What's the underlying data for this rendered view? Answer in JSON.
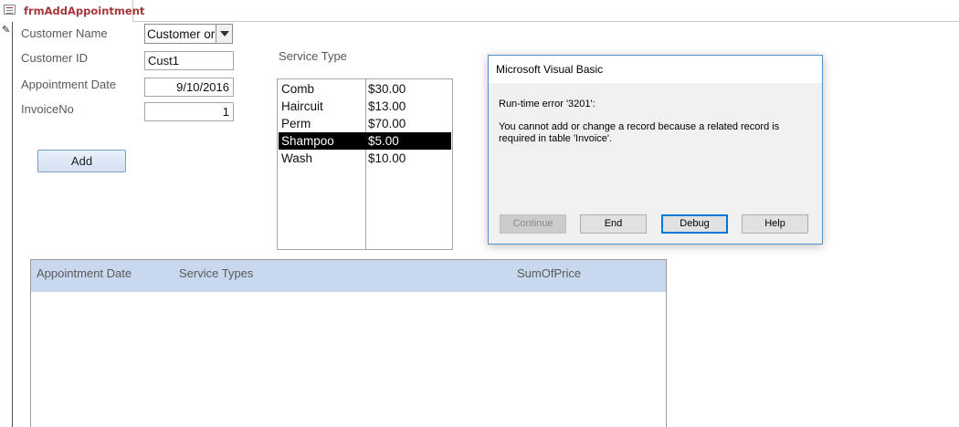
{
  "tab": {
    "title": "frmAddAppointment"
  },
  "form": {
    "customer_name_label": "Customer Name",
    "customer_name_value": "Customer or",
    "customer_id_label": "Customer ID",
    "customer_id_value": "Cust1",
    "appointment_date_label": "Appointment Date",
    "appointment_date_value": "9/10/2016",
    "invoice_no_label": "InvoiceNo",
    "invoice_no_value": "1",
    "add_button": "Add",
    "service_type_label": "Service Type"
  },
  "services": [
    {
      "name": "Comb",
      "price": "$30.00",
      "selected": false
    },
    {
      "name": "Haircuit",
      "price": "$13.00",
      "selected": false
    },
    {
      "name": "Perm",
      "price": "$70.00",
      "selected": false
    },
    {
      "name": "Shampoo",
      "price": "$5.00",
      "selected": true
    },
    {
      "name": "Wash",
      "price": "$10.00",
      "selected": false
    }
  ],
  "subform": {
    "columns": [
      "Appointment Date",
      "Service Types",
      "SumOfPrice"
    ]
  },
  "dialog": {
    "title": "Microsoft Visual Basic",
    "error_line": "Run-time error '3201':",
    "message": "You cannot add or change a record because a related record is required in table 'Invoice'.",
    "buttons": [
      "Continue",
      "End",
      "Debug",
      "Help"
    ]
  },
  "colors": {
    "tab_title": "#a4373a",
    "subform_header": "#c8d9ef",
    "selection": "#000000",
    "dialog_border": "#5b8fc7"
  }
}
